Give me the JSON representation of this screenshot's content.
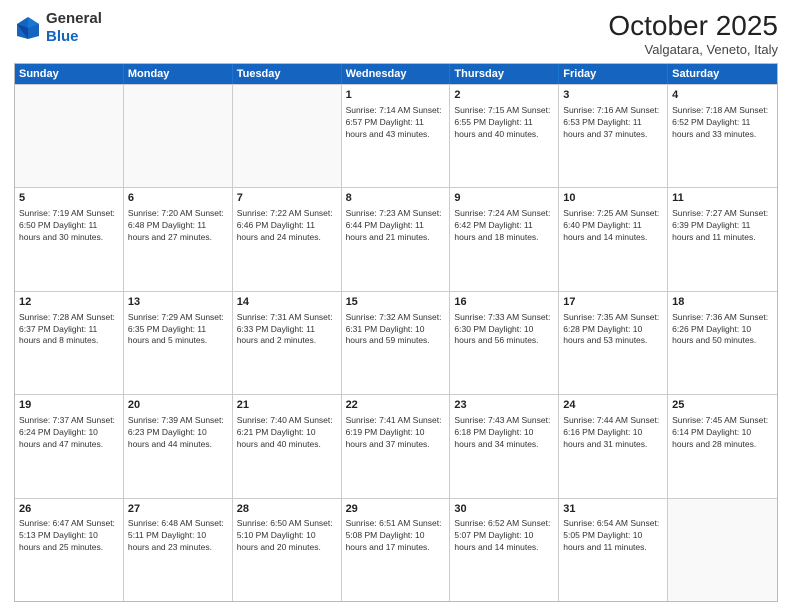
{
  "header": {
    "logo_general": "General",
    "logo_blue": "Blue",
    "title": "October 2025",
    "subtitle": "Valgatara, Veneto, Italy"
  },
  "weekdays": [
    "Sunday",
    "Monday",
    "Tuesday",
    "Wednesday",
    "Thursday",
    "Friday",
    "Saturday"
  ],
  "rows": [
    [
      {
        "day": "",
        "info": ""
      },
      {
        "day": "",
        "info": ""
      },
      {
        "day": "",
        "info": ""
      },
      {
        "day": "1",
        "info": "Sunrise: 7:14 AM\nSunset: 6:57 PM\nDaylight: 11 hours\nand 43 minutes."
      },
      {
        "day": "2",
        "info": "Sunrise: 7:15 AM\nSunset: 6:55 PM\nDaylight: 11 hours\nand 40 minutes."
      },
      {
        "day": "3",
        "info": "Sunrise: 7:16 AM\nSunset: 6:53 PM\nDaylight: 11 hours\nand 37 minutes."
      },
      {
        "day": "4",
        "info": "Sunrise: 7:18 AM\nSunset: 6:52 PM\nDaylight: 11 hours\nand 33 minutes."
      }
    ],
    [
      {
        "day": "5",
        "info": "Sunrise: 7:19 AM\nSunset: 6:50 PM\nDaylight: 11 hours\nand 30 minutes."
      },
      {
        "day": "6",
        "info": "Sunrise: 7:20 AM\nSunset: 6:48 PM\nDaylight: 11 hours\nand 27 minutes."
      },
      {
        "day": "7",
        "info": "Sunrise: 7:22 AM\nSunset: 6:46 PM\nDaylight: 11 hours\nand 24 minutes."
      },
      {
        "day": "8",
        "info": "Sunrise: 7:23 AM\nSunset: 6:44 PM\nDaylight: 11 hours\nand 21 minutes."
      },
      {
        "day": "9",
        "info": "Sunrise: 7:24 AM\nSunset: 6:42 PM\nDaylight: 11 hours\nand 18 minutes."
      },
      {
        "day": "10",
        "info": "Sunrise: 7:25 AM\nSunset: 6:40 PM\nDaylight: 11 hours\nand 14 minutes."
      },
      {
        "day": "11",
        "info": "Sunrise: 7:27 AM\nSunset: 6:39 PM\nDaylight: 11 hours\nand 11 minutes."
      }
    ],
    [
      {
        "day": "12",
        "info": "Sunrise: 7:28 AM\nSunset: 6:37 PM\nDaylight: 11 hours\nand 8 minutes."
      },
      {
        "day": "13",
        "info": "Sunrise: 7:29 AM\nSunset: 6:35 PM\nDaylight: 11 hours\nand 5 minutes."
      },
      {
        "day": "14",
        "info": "Sunrise: 7:31 AM\nSunset: 6:33 PM\nDaylight: 11 hours\nand 2 minutes."
      },
      {
        "day": "15",
        "info": "Sunrise: 7:32 AM\nSunset: 6:31 PM\nDaylight: 10 hours\nand 59 minutes."
      },
      {
        "day": "16",
        "info": "Sunrise: 7:33 AM\nSunset: 6:30 PM\nDaylight: 10 hours\nand 56 minutes."
      },
      {
        "day": "17",
        "info": "Sunrise: 7:35 AM\nSunset: 6:28 PM\nDaylight: 10 hours\nand 53 minutes."
      },
      {
        "day": "18",
        "info": "Sunrise: 7:36 AM\nSunset: 6:26 PM\nDaylight: 10 hours\nand 50 minutes."
      }
    ],
    [
      {
        "day": "19",
        "info": "Sunrise: 7:37 AM\nSunset: 6:24 PM\nDaylight: 10 hours\nand 47 minutes."
      },
      {
        "day": "20",
        "info": "Sunrise: 7:39 AM\nSunset: 6:23 PM\nDaylight: 10 hours\nand 44 minutes."
      },
      {
        "day": "21",
        "info": "Sunrise: 7:40 AM\nSunset: 6:21 PM\nDaylight: 10 hours\nand 40 minutes."
      },
      {
        "day": "22",
        "info": "Sunrise: 7:41 AM\nSunset: 6:19 PM\nDaylight: 10 hours\nand 37 minutes."
      },
      {
        "day": "23",
        "info": "Sunrise: 7:43 AM\nSunset: 6:18 PM\nDaylight: 10 hours\nand 34 minutes."
      },
      {
        "day": "24",
        "info": "Sunrise: 7:44 AM\nSunset: 6:16 PM\nDaylight: 10 hours\nand 31 minutes."
      },
      {
        "day": "25",
        "info": "Sunrise: 7:45 AM\nSunset: 6:14 PM\nDaylight: 10 hours\nand 28 minutes."
      }
    ],
    [
      {
        "day": "26",
        "info": "Sunrise: 6:47 AM\nSunset: 5:13 PM\nDaylight: 10 hours\nand 25 minutes."
      },
      {
        "day": "27",
        "info": "Sunrise: 6:48 AM\nSunset: 5:11 PM\nDaylight: 10 hours\nand 23 minutes."
      },
      {
        "day": "28",
        "info": "Sunrise: 6:50 AM\nSunset: 5:10 PM\nDaylight: 10 hours\nand 20 minutes."
      },
      {
        "day": "29",
        "info": "Sunrise: 6:51 AM\nSunset: 5:08 PM\nDaylight: 10 hours\nand 17 minutes."
      },
      {
        "day": "30",
        "info": "Sunrise: 6:52 AM\nSunset: 5:07 PM\nDaylight: 10 hours\nand 14 minutes."
      },
      {
        "day": "31",
        "info": "Sunrise: 6:54 AM\nSunset: 5:05 PM\nDaylight: 10 hours\nand 11 minutes."
      },
      {
        "day": "",
        "info": ""
      }
    ]
  ]
}
